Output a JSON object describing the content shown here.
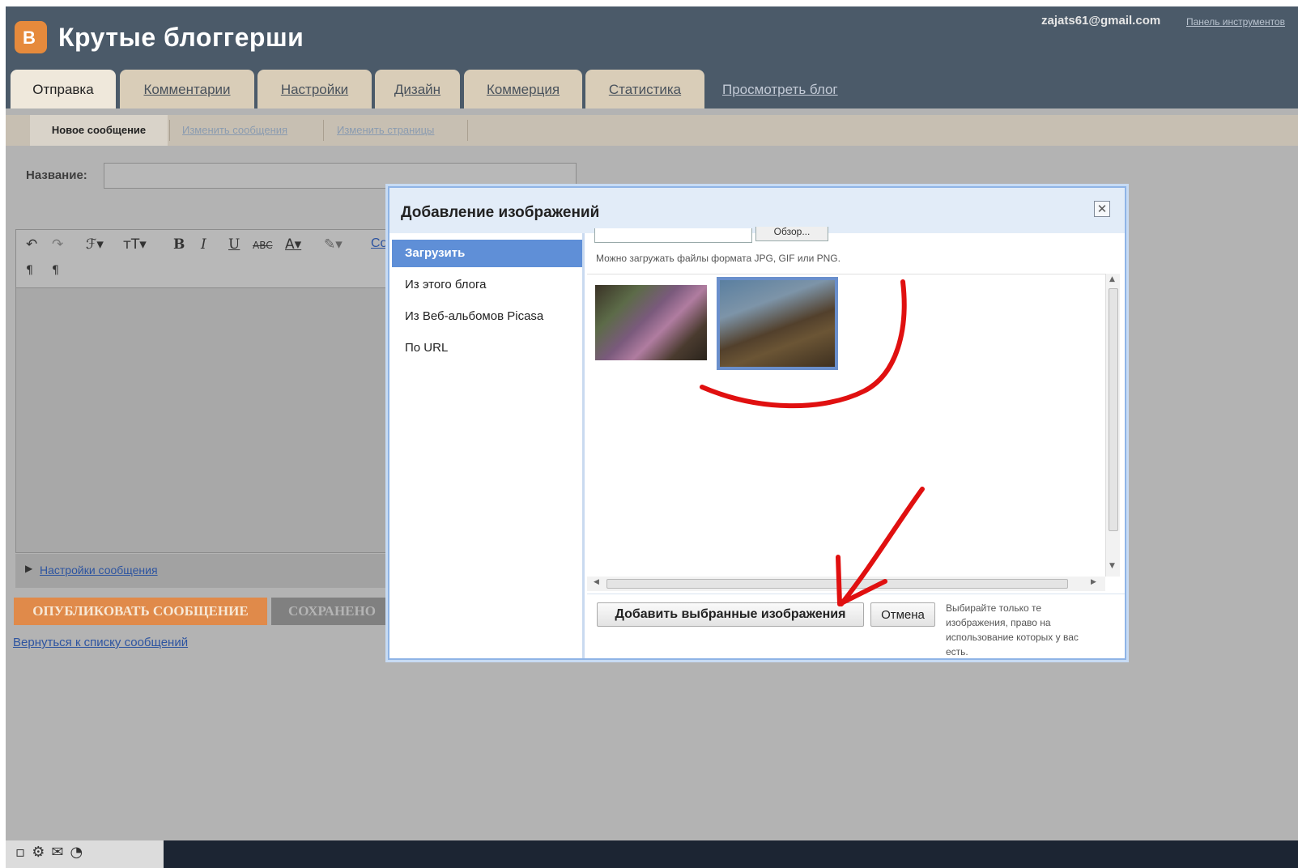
{
  "header": {
    "logo_glyph": "B",
    "blog_title": "Крутые блоггерши",
    "user_email": "zajats61@gmail.com",
    "dashboard_link": "Панель инструментов"
  },
  "tabs": [
    {
      "label": "Отправка",
      "active": true
    },
    {
      "label": "Комментарии",
      "active": false
    },
    {
      "label": "Настройки",
      "active": false
    },
    {
      "label": "Дизайн",
      "active": false
    },
    {
      "label": "Коммерция",
      "active": false
    },
    {
      "label": "Статистика",
      "active": false
    }
  ],
  "view_blog_link": "Просмотреть блог",
  "subnav": {
    "new_post": "Новое сообщение",
    "edit_posts": "Изменить сообщения",
    "edit_pages": "Изменить страницы"
  },
  "post": {
    "title_label": "Название:",
    "title_value": "",
    "toolbar_link": "Со",
    "settings_link": "Настройки сообщения",
    "publish_button": "ОПУБЛИКОВАТЬ СООБЩЕНИЕ",
    "saved_button": "СОХРАНЕНО",
    "back_link": "Вернуться к списку сообщений"
  },
  "modal": {
    "title": "Добавление изображений",
    "close_glyph": "✕",
    "nav": [
      {
        "label": "Загрузить",
        "active": true
      },
      {
        "label": "Из этого блога",
        "active": false
      },
      {
        "label": "Из Веб-альбомов Picasa",
        "active": false
      },
      {
        "label": "По URL",
        "active": false
      }
    ],
    "browse_button": "Обзор...",
    "upload_hint": "Можно загружать файлы формата JPG, GIF или PNG.",
    "images": [
      {
        "name": "photo-1",
        "selected": false
      },
      {
        "name": "photo-2",
        "selected": true
      }
    ],
    "add_selected_button": "Добавить выбранные изображения",
    "cancel_button": "Отмена",
    "rights_note": "Выбирайте только те изображения, право на использование которых у вас есть."
  },
  "colors": {
    "header_bg": "#4b5a69",
    "tab_bg": "#d9cdb8",
    "publish_orange": "#e08a4a",
    "modal_nav_active": "#5f8fd7",
    "annotation_red": "#e01010"
  },
  "icons": {
    "toolbar": [
      "undo-icon",
      "redo-icon",
      "font-icon",
      "font-size-icon",
      "bold-icon",
      "italic-icon",
      "underline-icon",
      "strikethrough-icon",
      "text-color-icon",
      "highlight-icon",
      "ltr-icon",
      "rtl-icon"
    ],
    "taskbar": [
      "tray-icon-1",
      "tray-icon-2",
      "tray-icon-3",
      "tray-icon-4"
    ]
  }
}
